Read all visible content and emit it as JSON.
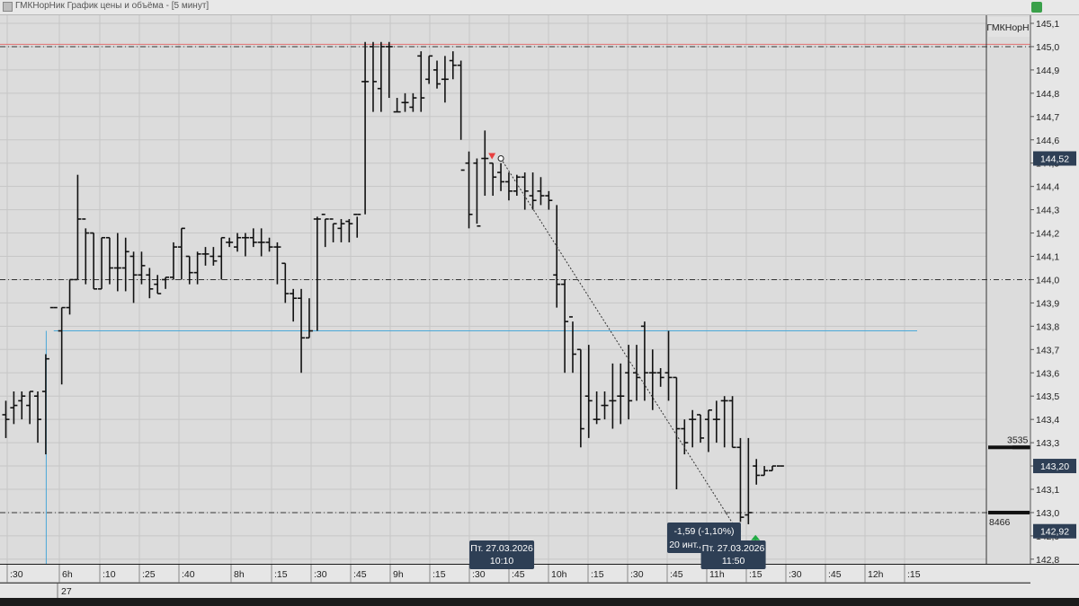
{
  "window": {
    "title": "ГМКНорНик График цены и объёма - [5 минут]"
  },
  "chart_data": {
    "type": "ohlc",
    "instrument_label": "ГМКНорН",
    "ylim": [
      142.8,
      145.1
    ],
    "y_ticks": [
      "145,1",
      "145,0",
      "144,9",
      "144,8",
      "144,7",
      "144,6",
      "144,5",
      "144,4",
      "144,3",
      "144,2",
      "144,1",
      "144,0",
      "143,9",
      "143,8",
      "143,7",
      "143,6",
      "143,5",
      "143,4",
      "143,3",
      "143,2",
      "143,1",
      "143,0",
      "142,9",
      "142,8"
    ],
    "x_ticks": [
      ":30",
      "6h",
      ":10",
      ":25",
      ":40",
      "8h",
      ":15",
      ":30",
      ":45",
      "9h",
      ":15",
      ":30",
      ":45",
      "10h",
      ":15",
      ":30",
      ":45",
      "11h",
      ":15",
      ":30",
      ":45",
      "12h",
      ":15"
    ],
    "date_label": "27",
    "price_badges": [
      {
        "id": "top-level",
        "text": "144,52",
        "value": 144.52
      },
      {
        "id": "mid-level",
        "text": "143,20",
        "value": 143.2
      },
      {
        "id": "low-level",
        "text": "142,92",
        "value": 142.92
      }
    ],
    "volume_labels": [
      {
        "text": "3535",
        "value": 143.28
      },
      {
        "text": "8466",
        "value": 143.0
      }
    ],
    "horizontal_lines": [
      {
        "value": 145.0,
        "style": "dash-dot",
        "color": "#333333"
      },
      {
        "value": 145.01,
        "style": "solid",
        "color": "#e07070"
      },
      {
        "value": 144.0,
        "style": "dash-dot",
        "color": "#333333"
      },
      {
        "value": 143.0,
        "style": "dash-dot",
        "color": "#333333"
      },
      {
        "value": 143.78,
        "style": "solid",
        "color": "#4aa8d8",
        "from_bar": 6
      }
    ],
    "bars": [
      [
        143.42,
        143.48,
        143.32,
        143.4
      ],
      [
        143.45,
        143.52,
        143.38,
        143.46
      ],
      [
        143.48,
        143.52,
        143.4,
        143.5
      ],
      [
        143.46,
        143.52,
        143.38,
        143.52
      ],
      [
        143.5,
        143.52,
        143.3,
        143.4
      ],
      [
        143.52,
        143.68,
        143.25,
        143.66
      ],
      [
        143.88,
        143.88,
        143.88,
        143.88
      ],
      [
        143.78,
        143.88,
        143.55,
        143.88
      ],
      [
        143.88,
        144.0,
        143.85,
        144.0
      ],
      [
        144.0,
        144.45,
        144.0,
        144.26
      ],
      [
        144.26,
        144.22,
        143.98,
        144.2
      ],
      [
        144.2,
        144.2,
        143.96,
        143.96
      ],
      [
        143.96,
        144.18,
        143.96,
        144.18
      ],
      [
        144.18,
        144.18,
        143.98,
        144.05
      ],
      [
        144.05,
        144.2,
        143.95,
        144.05
      ],
      [
        144.05,
        144.18,
        143.95,
        144.12
      ],
      [
        144.1,
        144.12,
        143.9,
        144.02
      ],
      [
        144.02,
        144.12,
        143.98,
        144.06
      ],
      [
        144.02,
        144.05,
        143.92,
        143.96
      ],
      [
        143.98,
        144.02,
        143.94,
        143.94
      ],
      [
        144.0,
        144.01,
        143.96,
        144.01
      ],
      [
        144.01,
        144.16,
        144.0,
        144.14
      ],
      [
        144.14,
        144.22,
        144.0,
        144.22
      ],
      [
        144.1,
        144.1,
        143.98,
        144.03
      ],
      [
        144.03,
        144.12,
        143.98,
        144.11
      ],
      [
        144.11,
        144.14,
        144.06,
        144.11
      ],
      [
        144.1,
        144.14,
        144.06,
        144.08
      ],
      [
        144.1,
        144.18,
        144.0,
        144.18
      ],
      [
        144.16,
        144.18,
        144.14,
        144.16
      ],
      [
        144.14,
        144.2,
        144.12,
        144.18
      ],
      [
        144.18,
        144.2,
        144.1,
        144.18
      ],
      [
        144.18,
        144.22,
        144.14,
        144.16
      ],
      [
        144.16,
        144.22,
        144.1,
        144.16
      ],
      [
        144.16,
        144.18,
        144.12,
        144.14
      ],
      [
        144.14,
        144.16,
        143.98,
        144.14
      ],
      [
        144.07,
        144.07,
        143.9,
        143.94
      ],
      [
        143.94,
        143.96,
        143.82,
        143.92
      ],
      [
        143.92,
        143.96,
        143.6,
        143.75
      ],
      [
        143.75,
        143.92,
        143.75,
        143.78
      ],
      [
        144.26,
        144.27,
        143.78,
        144.26
      ],
      [
        144.28,
        144.26,
        144.14,
        144.26
      ],
      [
        144.26,
        144.24,
        144.16,
        144.24
      ],
      [
        144.22,
        144.26,
        144.16,
        144.24
      ],
      [
        144.25,
        144.26,
        144.16,
        144.24
      ],
      [
        144.28,
        144.27,
        144.18,
        144.28
      ],
      [
        144.85,
        145.02,
        144.28,
        144.85
      ],
      [
        145.0,
        145.02,
        144.72,
        144.85
      ],
      [
        144.82,
        145.02,
        144.72,
        145.0
      ],
      [
        145.0,
        145.02,
        144.78,
        145.0
      ],
      [
        144.72,
        144.78,
        144.72,
        144.72
      ],
      [
        144.76,
        144.8,
        144.72,
        144.76
      ],
      [
        144.74,
        144.8,
        144.72,
        144.78
      ],
      [
        144.96,
        144.98,
        144.72,
        144.78
      ],
      [
        144.86,
        144.96,
        144.84,
        144.96
      ],
      [
        144.9,
        144.94,
        144.82,
        144.84
      ],
      [
        144.86,
        144.96,
        144.76,
        144.86
      ],
      [
        144.94,
        144.98,
        144.86,
        144.92
      ],
      [
        144.92,
        144.94,
        144.6,
        144.47
      ],
      [
        144.5,
        144.55,
        144.22,
        144.28
      ],
      [
        144.5,
        144.52,
        144.24,
        144.23
      ],
      [
        144.52,
        144.64,
        144.36,
        144.52
      ],
      [
        144.5,
        144.5,
        144.36,
        144.44
      ],
      [
        144.46,
        144.5,
        144.38,
        144.42
      ],
      [
        144.42,
        144.46,
        144.34,
        144.38
      ],
      [
        144.38,
        144.45,
        144.36,
        144.44
      ],
      [
        144.44,
        144.46,
        144.3,
        144.38
      ],
      [
        144.36,
        144.46,
        144.3,
        144.34
      ],
      [
        144.38,
        144.44,
        144.32,
        144.36
      ],
      [
        144.36,
        144.38,
        144.3,
        144.34
      ],
      [
        144.02,
        144.32,
        143.88,
        143.98
      ],
      [
        143.98,
        144.0,
        143.6,
        143.82
      ],
      [
        143.84,
        143.82,
        143.6,
        143.68
      ],
      [
        143.7,
        143.7,
        143.28,
        143.36
      ],
      [
        143.5,
        143.72,
        143.32,
        143.48
      ],
      [
        143.4,
        143.52,
        143.38,
        143.4
      ],
      [
        143.46,
        143.52,
        143.4,
        143.46
      ],
      [
        143.48,
        143.64,
        143.36,
        143.48
      ],
      [
        143.5,
        143.64,
        143.38,
        143.5
      ],
      [
        143.6,
        143.72,
        143.4,
        143.48
      ],
      [
        143.6,
        143.72,
        143.48,
        143.58
      ],
      [
        143.8,
        143.82,
        143.48,
        143.6
      ],
      [
        143.6,
        143.7,
        143.44,
        143.6
      ],
      [
        143.6,
        143.62,
        143.54,
        143.58
      ],
      [
        143.6,
        143.78,
        143.48,
        143.58
      ],
      [
        143.58,
        143.58,
        143.1,
        143.36
      ],
      [
        143.36,
        143.4,
        143.25,
        143.3
      ],
      [
        143.4,
        143.44,
        143.28,
        143.4
      ],
      [
        143.42,
        143.42,
        143.3,
        143.32
      ],
      [
        143.4,
        143.44,
        143.26,
        143.44
      ],
      [
        143.4,
        143.48,
        143.3,
        143.4
      ],
      [
        143.48,
        143.5,
        143.28,
        143.48
      ],
      [
        143.48,
        143.5,
        143.28,
        143.28
      ],
      [
        143.28,
        143.32,
        142.96,
        142.98
      ],
      [
        142.99,
        143.32,
        142.95,
        143.0
      ],
      [
        143.2,
        143.23,
        143.12,
        143.16
      ],
      [
        143.16,
        143.2,
        143.16,
        143.18
      ],
      [
        143.18,
        143.2,
        143.18,
        143.2
      ],
      [
        143.2,
        143.2,
        143.2,
        143.2
      ]
    ],
    "signals": [
      {
        "type": "sell",
        "bar": 61,
        "value": 144.52,
        "color": "#e84040"
      },
      {
        "type": "buy",
        "bar": 94,
        "value": 142.92,
        "color": "#22aa44"
      }
    ],
    "measure": {
      "from_bar": 62,
      "from_value": 144.52,
      "to_bar": 91,
      "to_value": 142.93,
      "label_line1": "-1,59 (-1,10%)",
      "label_line2": "20 инт., 1 ч 40 м"
    },
    "time_badges": [
      {
        "line1": "Пт. 27.03.2026",
        "line2": "10:10",
        "bar": 62
      },
      {
        "line1": "Пт. 27.03.2026",
        "line2": "11:50",
        "bar": 91
      }
    ]
  }
}
